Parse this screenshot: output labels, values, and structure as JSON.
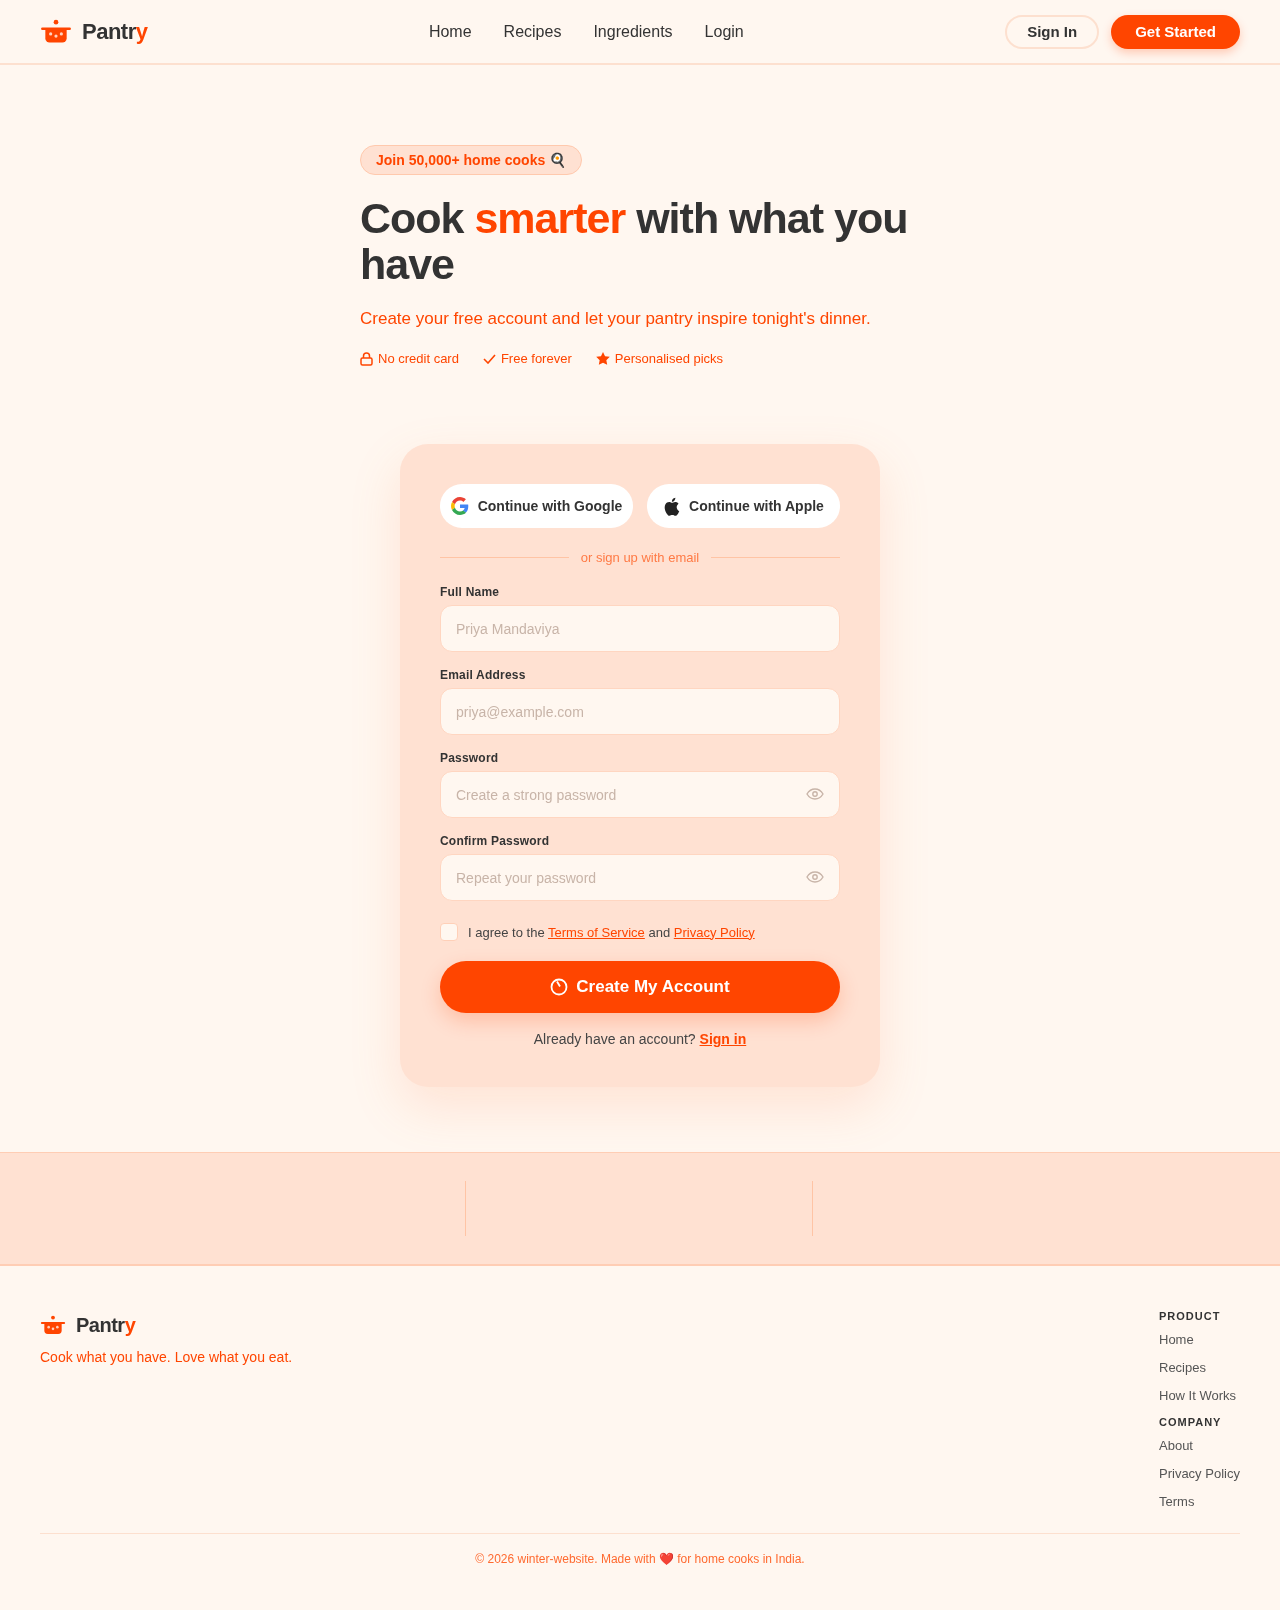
{
  "nav": {
    "brand": {
      "text": "Pantr",
      "accent": "y"
    },
    "links": [
      "Home",
      "Recipes",
      "Ingredients",
      "Login"
    ],
    "buttons": [
      {
        "label": "Sign In",
        "kind": "outline"
      },
      {
        "label": "Get Started",
        "kind": "solid"
      }
    ]
  },
  "hero": {
    "badge": "Join 50,000+ home cooks 🍳",
    "headline": [
      {
        "text": "Cook ",
        "highlight": false
      },
      {
        "text": "smarter",
        "highlight": true
      },
      {
        "text": " with what you have",
        "highlight": false
      }
    ],
    "subtitle": "Create your free account and let your pantry inspire tonight's dinner.",
    "perks": [
      {
        "label": "No credit card",
        "kind": "lock"
      },
      {
        "label": "Free forever",
        "kind": "check"
      },
      {
        "label": "Personalised picks",
        "kind": "star"
      }
    ]
  },
  "form": {
    "social": [
      {
        "label": "Continue with Google",
        "kind": "google"
      },
      {
        "label": "Continue with Apple",
        "kind": "apple"
      }
    ],
    "divider": "or sign up with email",
    "fields": [
      {
        "label": "Full Name",
        "placeholder": "Priya Mandaviya",
        "kind": "text"
      },
      {
        "label": "Email Address",
        "placeholder": "priya@example.com",
        "kind": "email"
      },
      {
        "label": "Password",
        "placeholder": "Create a strong password",
        "kind": "password"
      },
      {
        "label": "Confirm Password",
        "placeholder": "Repeat your password",
        "kind": "password"
      }
    ],
    "agree": {
      "checked": false,
      "before": "I agree to the",
      "link1": "Terms of Service",
      "middle": "and",
      "link2": "Privacy Policy"
    },
    "submit": "Create My Account",
    "signin": {
      "text": "Already have an account?",
      "link": "Sign in"
    }
  },
  "footer": {
    "brand": {
      "text": "Pantr",
      "accent": "y"
    },
    "tagline": "Cook what you have. Love what you eat.",
    "columns": [
      {
        "title": "PRODUCT",
        "links": [
          "Home",
          "Recipes",
          "How It Works"
        ]
      },
      {
        "title": "COMPANY",
        "links": [
          "About",
          "Privacy Policy",
          "Terms"
        ]
      }
    ],
    "copyright": "© 2026 winter-website. Made with ❤️ for home cooks in India."
  }
}
